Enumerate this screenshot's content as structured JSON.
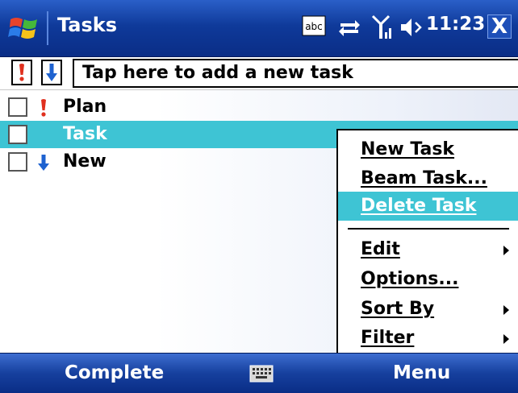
{
  "titlebar": {
    "app_title": "Tasks",
    "clock": "11:23",
    "close_label": "X",
    "icons": [
      "windows-start-icon",
      "input-method-icon",
      "connectivity-icon",
      "signal-icon",
      "volume-icon"
    ]
  },
  "add_row": {
    "placeholder": "Tap here to add a new task",
    "high_priority_icon": "high-priority-icon",
    "low_priority_icon": "low-priority-icon"
  },
  "tasks": [
    {
      "label": "Plan",
      "priority": "high",
      "checked": false,
      "selected": false
    },
    {
      "label": "Task",
      "priority": "normal",
      "checked": false,
      "selected": true
    },
    {
      "label": "New",
      "priority": "low",
      "checked": false,
      "selected": false
    }
  ],
  "context_menu": {
    "items": [
      {
        "label": "New Task",
        "submenu": false,
        "highlighted": false
      },
      {
        "label": "Beam Task...",
        "submenu": false,
        "highlighted": false
      },
      {
        "label": "Delete Task",
        "submenu": false,
        "highlighted": true
      },
      {
        "label": "Edit",
        "submenu": true,
        "highlighted": false
      },
      {
        "label": "Options...",
        "submenu": false,
        "highlighted": false
      },
      {
        "label": "Sort By",
        "submenu": true,
        "highlighted": false
      },
      {
        "label": "Filter",
        "submenu": true,
        "highlighted": false
      }
    ]
  },
  "softkeys": {
    "left": "Complete",
    "right": "Menu",
    "keyboard_icon": "keyboard-icon"
  },
  "colors": {
    "titlebar": "#0f3a9a",
    "selection": "#3ec4d4",
    "high_priority": "#e0301e",
    "low_priority": "#1e62d0"
  }
}
